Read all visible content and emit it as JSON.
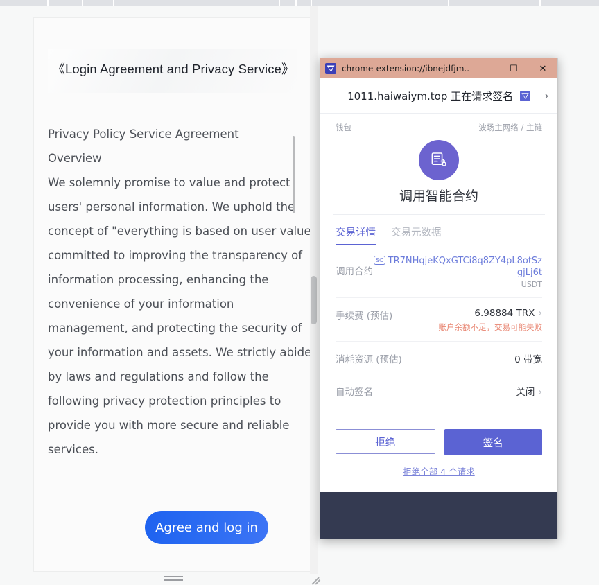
{
  "browser": {
    "tab_strip_ticks": [
      68,
      118,
      163,
      402,
      426,
      448,
      646,
      778
    ]
  },
  "agreement": {
    "title": "《Login Agreement and Privacy Service》",
    "lines": [
      "Privacy Policy Service Agreement",
      "Overview",
      "We solemnly promise to value and protect",
      "users' personal information. We uphold the",
      "concept of \"everything is based on user value\",",
      "committed to improving the transparency of",
      "information processing, enhancing the",
      "convenience of your information",
      "management, and protecting the security of",
      "your information and assets. We strictly abide",
      "by laws and regulations and follow the",
      "following privacy protection principles to",
      "provide you with more secure and reliable",
      "services."
    ],
    "agree_button_label": "Agree and log in"
  },
  "tronlink": {
    "titlebar": {
      "text": "chrome-extension://ibnejdfjm...",
      "minimize": "—",
      "maximize": "☐",
      "close": "✕"
    },
    "request_header": {
      "text": "1011.haiwaiym.top 正在请求签名",
      "chevron": "›"
    },
    "meta": {
      "wallet_label": "钱包",
      "network_label": "波场主网络 / 主链"
    },
    "hero": {
      "title": "调用智能合约"
    },
    "tabs": [
      {
        "label": "交易详情",
        "active": true
      },
      {
        "label": "交易元数据",
        "active": false
      }
    ],
    "details": [
      {
        "label": "调用合约",
        "badge": "SC",
        "value": "TR7NHqjeKQxGTCi8q8ZY4pL8otSzgjLj6t",
        "sub": "USDT"
      },
      {
        "label": "手续费 (预估)",
        "value": "6.98884 TRX",
        "chevron": "›",
        "warning": "账户余额不足，交易可能失败"
      },
      {
        "label": "消耗资源 (预估)",
        "value": "0 带宽"
      },
      {
        "label": "自动签名",
        "value": "关闭",
        "chevron": "›"
      }
    ],
    "footer": {
      "reject_label": "拒绝",
      "sign_label": "签名",
      "reject_all_label": "拒绝全部 4 个请求"
    }
  },
  "colors": {
    "titlebar_bg": "#dda896",
    "accent_purple": "#5b63d3",
    "hero_circle": "#6c63cf",
    "link_blue": "#6c7cdb",
    "warning_red": "#e8836f",
    "dark_panel": "#343a51",
    "agree_button_blue": "#2a6bf2"
  }
}
